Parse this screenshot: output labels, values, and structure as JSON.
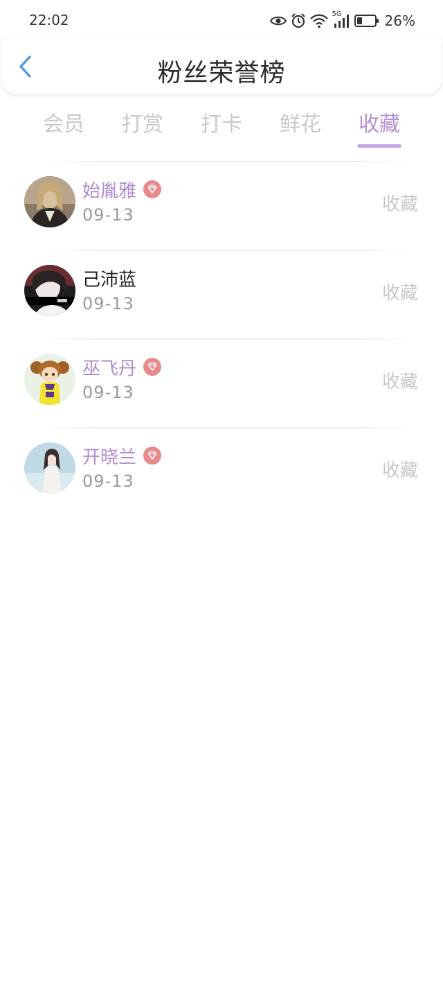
{
  "status_bar": {
    "time": "22:02",
    "network": "5G",
    "battery": "26%",
    "icons": [
      "eye-icon",
      "alarm-icon",
      "wifi-icon",
      "signal-icon",
      "battery-icon"
    ]
  },
  "header": {
    "title": "粉丝荣誉榜",
    "back_icon": "chevron-left-icon",
    "back_color": "#4a9be0"
  },
  "tabs": [
    {
      "label": "会员",
      "active": false
    },
    {
      "label": "打赏",
      "active": false
    },
    {
      "label": "打卡",
      "active": false
    },
    {
      "label": "鲜花",
      "active": false
    },
    {
      "label": "收藏",
      "active": true
    }
  ],
  "colors": {
    "accent": "#b58fd4",
    "vip_name": "#b18bcf",
    "vip_badge": "#e88a8a",
    "muted_text": "#9a9a9a",
    "inactive_tab": "#c9c9c9"
  },
  "fans": [
    {
      "name": "始胤雅",
      "vip": true,
      "date": "09-13",
      "action": "收藏",
      "avatar": "photo-avatar-woman-jacket"
    },
    {
      "name": "己沛蓝",
      "vip": false,
      "date": "09-13",
      "action": "收藏",
      "avatar": "photo-avatar-dark-portrait"
    },
    {
      "name": "巫飞丹",
      "vip": true,
      "date": "09-13",
      "action": "收藏",
      "avatar": "cartoon-avatar-girl-yellow"
    },
    {
      "name": "开晓兰",
      "vip": true,
      "date": "09-13",
      "action": "收藏",
      "avatar": "photo-avatar-girl-outdoor"
    }
  ]
}
